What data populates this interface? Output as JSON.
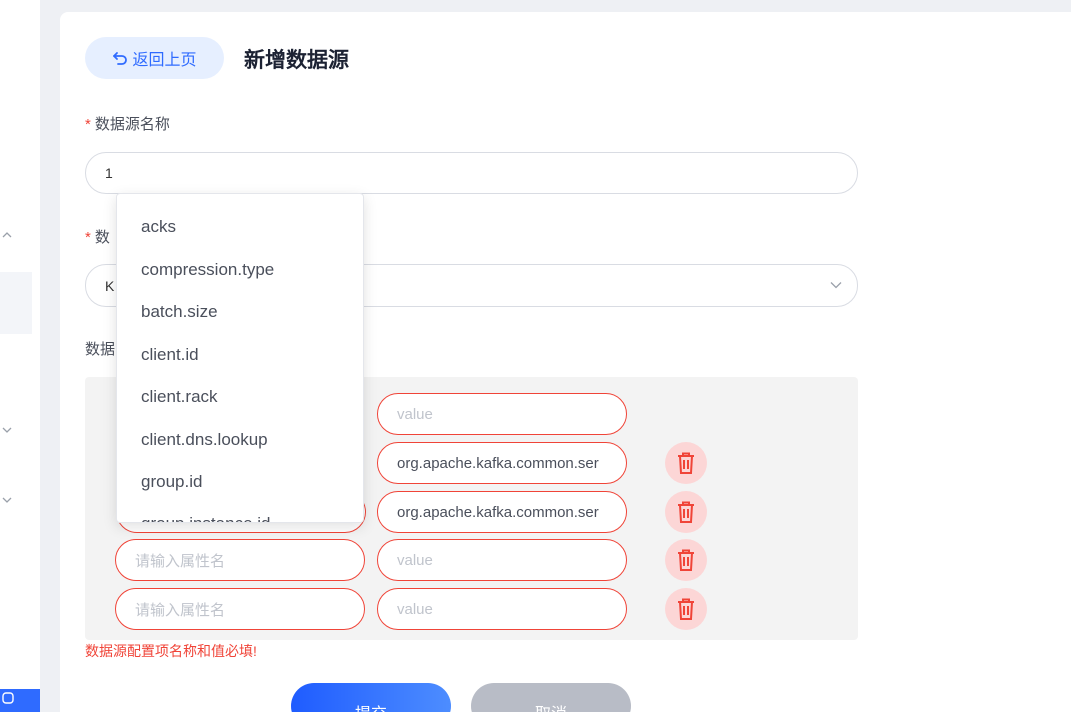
{
  "header": {
    "back_label": "返回上页",
    "title": "新增数据源"
  },
  "form": {
    "name_label": "数据源名称",
    "name_value": "1",
    "type_label_partial": "数",
    "type_value_partial": "K",
    "props_label_partial": "数据"
  },
  "properties": {
    "rows": [
      {
        "key_placeholder": "",
        "value_placeholder": "value",
        "value": "",
        "deletable": false
      },
      {
        "key_placeholder": "",
        "value_placeholder": "",
        "value": "org.apache.kafka.common.ser",
        "deletable": true
      },
      {
        "key_placeholder": "",
        "value_placeholder": "",
        "value": "org.apache.kafka.common.ser",
        "deletable": true
      },
      {
        "key_placeholder": "请输入属性名",
        "value_placeholder": "value",
        "value": "",
        "deletable": true
      },
      {
        "key_placeholder": "请输入属性名",
        "value_placeholder": "value",
        "value": "",
        "deletable": true
      }
    ],
    "error": "数据源配置项名称和值必填!"
  },
  "dropdown": {
    "options": [
      "acks",
      "compression.type",
      "batch.size",
      "client.id",
      "client.rack",
      "client.dns.lookup",
      "group.id",
      "group.instance.id"
    ]
  },
  "actions": {
    "submit_label": "提交",
    "cancel_label": "取消"
  },
  "colors": {
    "primary": "#2f6bff",
    "error": "#f04438",
    "delete_bg": "#fcd6d6"
  }
}
